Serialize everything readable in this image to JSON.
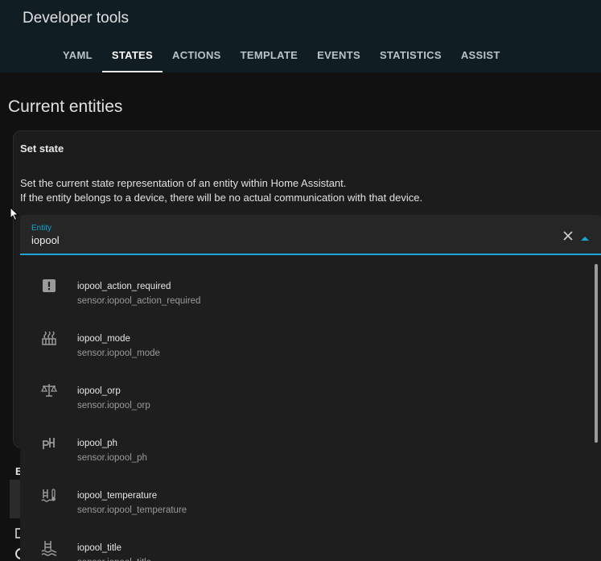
{
  "header": {
    "title": "Developer tools",
    "tabs": [
      {
        "label": "YAML",
        "active": false
      },
      {
        "label": "STATES",
        "active": true
      },
      {
        "label": "ACTIONS",
        "active": false
      },
      {
        "label": "TEMPLATE",
        "active": false
      },
      {
        "label": "EVENTS",
        "active": false
      },
      {
        "label": "STATISTICS",
        "active": false
      },
      {
        "label": "ASSIST",
        "active": false
      }
    ]
  },
  "page": {
    "title": "Current entities"
  },
  "set_state": {
    "title": "Set state",
    "description_line1": "Set the current state representation of an entity within Home Assistant.",
    "description_line2": "If the entity belongs to a device, there will be no actual communication with that device."
  },
  "entity_field": {
    "label": "Entity",
    "value": "iopool"
  },
  "dropdown": {
    "items": [
      {
        "name": "iopool_action_required",
        "entity_id": "sensor.iopool_action_required",
        "icon": "alert-box-icon"
      },
      {
        "name": "iopool_mode",
        "entity_id": "sensor.iopool_mode",
        "icon": "pool-heater-icon"
      },
      {
        "name": "iopool_orp",
        "entity_id": "sensor.iopool_orp",
        "icon": "scale-balance-icon"
      },
      {
        "name": "iopool_ph",
        "entity_id": "sensor.iopool_ph",
        "icon": "ph-icon"
      },
      {
        "name": "iopool_temperature",
        "entity_id": "sensor.iopool_temperature",
        "icon": "pool-thermometer-icon"
      },
      {
        "name": "iopool_title",
        "entity_id": "sensor.iopool_title",
        "icon": "pool-icon"
      }
    ]
  },
  "behind": {
    "section_letter": "E"
  },
  "colors": {
    "header_bg": "#101e24",
    "page_bg": "#111111",
    "accent": "#18a5d6",
    "dropdown_bg": "#1e1e1e"
  }
}
